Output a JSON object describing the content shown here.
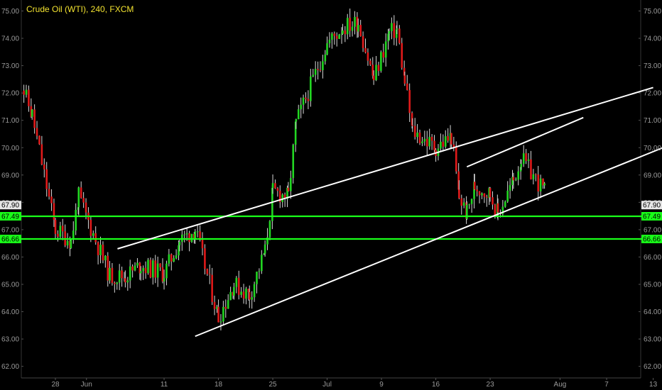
{
  "title": "Crude Oil (WTI), 240, FXCM",
  "colors": {
    "background": "#000000",
    "up": "#22d622",
    "down": "#e01a1a",
    "wick": "#d8d8d8",
    "level": "#19ff19",
    "trend": "#ffffff",
    "axis_text": "#9a9a9a"
  },
  "chart_data": {
    "type": "candlestick",
    "title": "Crude Oil (WTI), 240, FXCM",
    "ylim": [
      61.8,
      75.3
    ],
    "y_ticks": [
      "62.00",
      "63.00",
      "64.00",
      "65.00",
      "66.00",
      "67.00",
      "68.00",
      "69.00",
      "70.00",
      "71.00",
      "72.00",
      "73.00",
      "74.00",
      "75.00"
    ],
    "x_tick_labels": [
      "28",
      "Jun",
      "11",
      "18",
      "25",
      "Jul",
      "9",
      "16",
      "23",
      "Aug",
      "7",
      "13"
    ],
    "price_tags": [
      {
        "label": "67.90",
        "value": 67.9,
        "style": "price"
      },
      {
        "label": "67.49",
        "value": 67.49,
        "style": "level"
      },
      {
        "label": "66.66",
        "value": 66.66,
        "style": "level"
      }
    ],
    "horizontal_levels": [
      67.49,
      66.66
    ],
    "trendlines": [
      {
        "from": [
          "Jun 5",
          66.3
        ],
        "to": [
          "Aug 13",
          72.2
        ]
      },
      {
        "from": [
          "Jun 15",
          63.1
        ],
        "to": [
          "Aug 16",
          70.2
        ]
      },
      {
        "from": [
          "Jul 20",
          69.3
        ],
        "to": [
          "Aug 4",
          71.1
        ]
      }
    ],
    "close_path": [
      {
        "date": "May 23",
        "close": 72.8
      },
      {
        "date": "May 25",
        "close": 71.2
      },
      {
        "date": "May 28",
        "close": 67.0
      },
      {
        "date": "May 30",
        "close": 66.6
      },
      {
        "date": "May 31",
        "close": 68.2
      },
      {
        "date": "Jun 4",
        "close": 65.3
      },
      {
        "date": "Jun 6",
        "close": 65.3
      },
      {
        "date": "Jun 8",
        "close": 65.7
      },
      {
        "date": "Jun 11",
        "close": 65.4
      },
      {
        "date": "Jun 13",
        "close": 66.6
      },
      {
        "date": "Jun 15",
        "close": 67.0
      },
      {
        "date": "Jun 18",
        "close": 63.8
      },
      {
        "date": "Jun 20",
        "close": 65.0
      },
      {
        "date": "Jun 22",
        "close": 64.6
      },
      {
        "date": "Jun 24",
        "close": 66.2
      },
      {
        "date": "Jun 25",
        "close": 68.4
      },
      {
        "date": "Jun 27",
        "close": 68.2
      },
      {
        "date": "Jun 28",
        "close": 70.9
      },
      {
        "date": "Jul 2",
        "close": 73.8
      },
      {
        "date": "Jul 4",
        "close": 74.4
      },
      {
        "date": "Jul 6",
        "close": 74.6
      },
      {
        "date": "Jul 8",
        "close": 72.5
      },
      {
        "date": "Jul 10",
        "close": 74.2
      },
      {
        "date": "Jul 11",
        "close": 74.3
      },
      {
        "date": "Jul 12",
        "close": 72.4
      },
      {
        "date": "Jul 13",
        "close": 70.6
      },
      {
        "date": "Jul 16",
        "close": 70.0
      },
      {
        "date": "Jul 18",
        "close": 70.4
      },
      {
        "date": "Jul 19",
        "close": 68.2
      },
      {
        "date": "Jul 20",
        "close": 67.6
      },
      {
        "date": "Jul 21",
        "close": 68.6
      },
      {
        "date": "Jul 23",
        "close": 68.3
      },
      {
        "date": "Jul 24",
        "close": 67.6
      },
      {
        "date": "Jul 26",
        "close": 68.8
      },
      {
        "date": "Jul 27",
        "close": 69.6
      },
      {
        "date": "Jul 30",
        "close": 68.4
      },
      {
        "date": "Jul 31",
        "close": 70.2
      },
      {
        "date": "Aug 1",
        "close": 69.3
      },
      {
        "date": "Aug 2",
        "close": 67.9
      }
    ]
  }
}
